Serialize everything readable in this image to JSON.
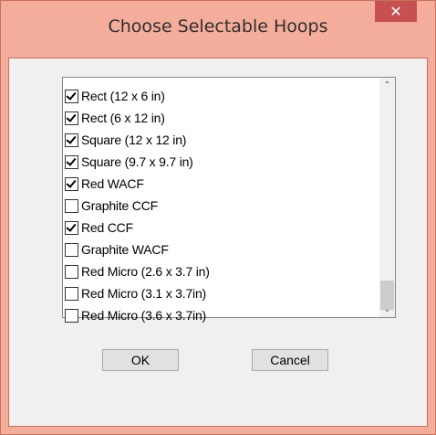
{
  "dialog": {
    "title": "Choose Selectable Hoops",
    "close_glyph": "✕"
  },
  "hoops": [
    {
      "label": "Rect (12 x 6 in)",
      "checked": true
    },
    {
      "label": "Rect (6 x 12 in)",
      "checked": true
    },
    {
      "label": "Square (12 x 12 in)",
      "checked": true
    },
    {
      "label": "Square (9.7 x 9.7 in)",
      "checked": true
    },
    {
      "label": "Red WACF",
      "checked": true
    },
    {
      "label": "Graphite CCF",
      "checked": false
    },
    {
      "label": "Red CCF",
      "checked": true
    },
    {
      "label": "Graphite WACF",
      "checked": false
    },
    {
      "label": "Red Micro (2.6 x 3.7 in)",
      "checked": false
    },
    {
      "label": "Red Micro (3.1 x 3.7in)",
      "checked": false
    },
    {
      "label": "Red Micro (3.6 x 3.7in)",
      "checked": false
    }
  ],
  "scrollbar": {
    "up_glyph": "⌃",
    "down_glyph": "⌄",
    "position": 0.95
  },
  "buttons": {
    "ok_label": "OK",
    "cancel_label": "Cancel"
  },
  "colors": {
    "frame": "#f4ad9b",
    "close": "#c75050",
    "client": "#f0f0f0"
  }
}
